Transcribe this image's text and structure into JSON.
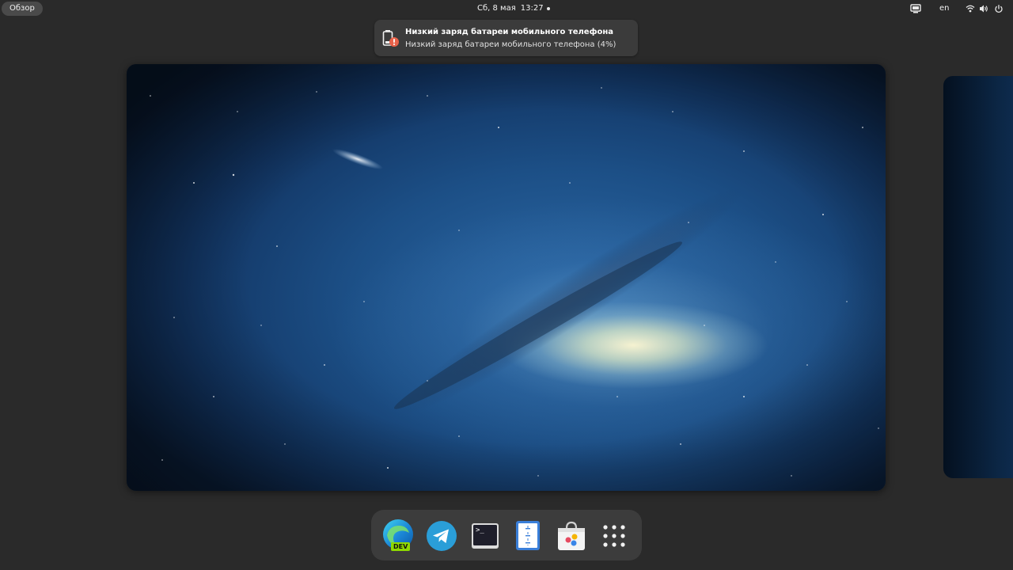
{
  "topbar": {
    "activities_label": "Обзор",
    "date": "Сб, 8 мая",
    "time": "13:27",
    "language": "en",
    "tray_icons": [
      "display-icon",
      "wifi-icon",
      "volume-icon",
      "power-icon"
    ]
  },
  "notification": {
    "icon": "battery-warning-icon",
    "title": "Низкий заряд батареи мобильного телефона",
    "body": "Низкий заряд батареи мобильного телефона (4%)"
  },
  "dash": {
    "items": [
      {
        "name": "microsoft-edge-dev",
        "icon": "edge-dev-icon",
        "badge": "DEV"
      },
      {
        "name": "telegram",
        "icon": "telegram-icon"
      },
      {
        "name": "terminal",
        "icon": "terminal-icon",
        "prompt": ">_"
      },
      {
        "name": "text-editor",
        "icon": "text-editor-icon"
      },
      {
        "name": "software-store",
        "icon": "store-icon"
      },
      {
        "name": "show-applications",
        "icon": "app-grid-icon"
      }
    ]
  },
  "colors": {
    "panel": "#2a2a2a",
    "dash": "#3c3c3c",
    "notification": "#3b3b3b",
    "warning": "#e8624a"
  }
}
